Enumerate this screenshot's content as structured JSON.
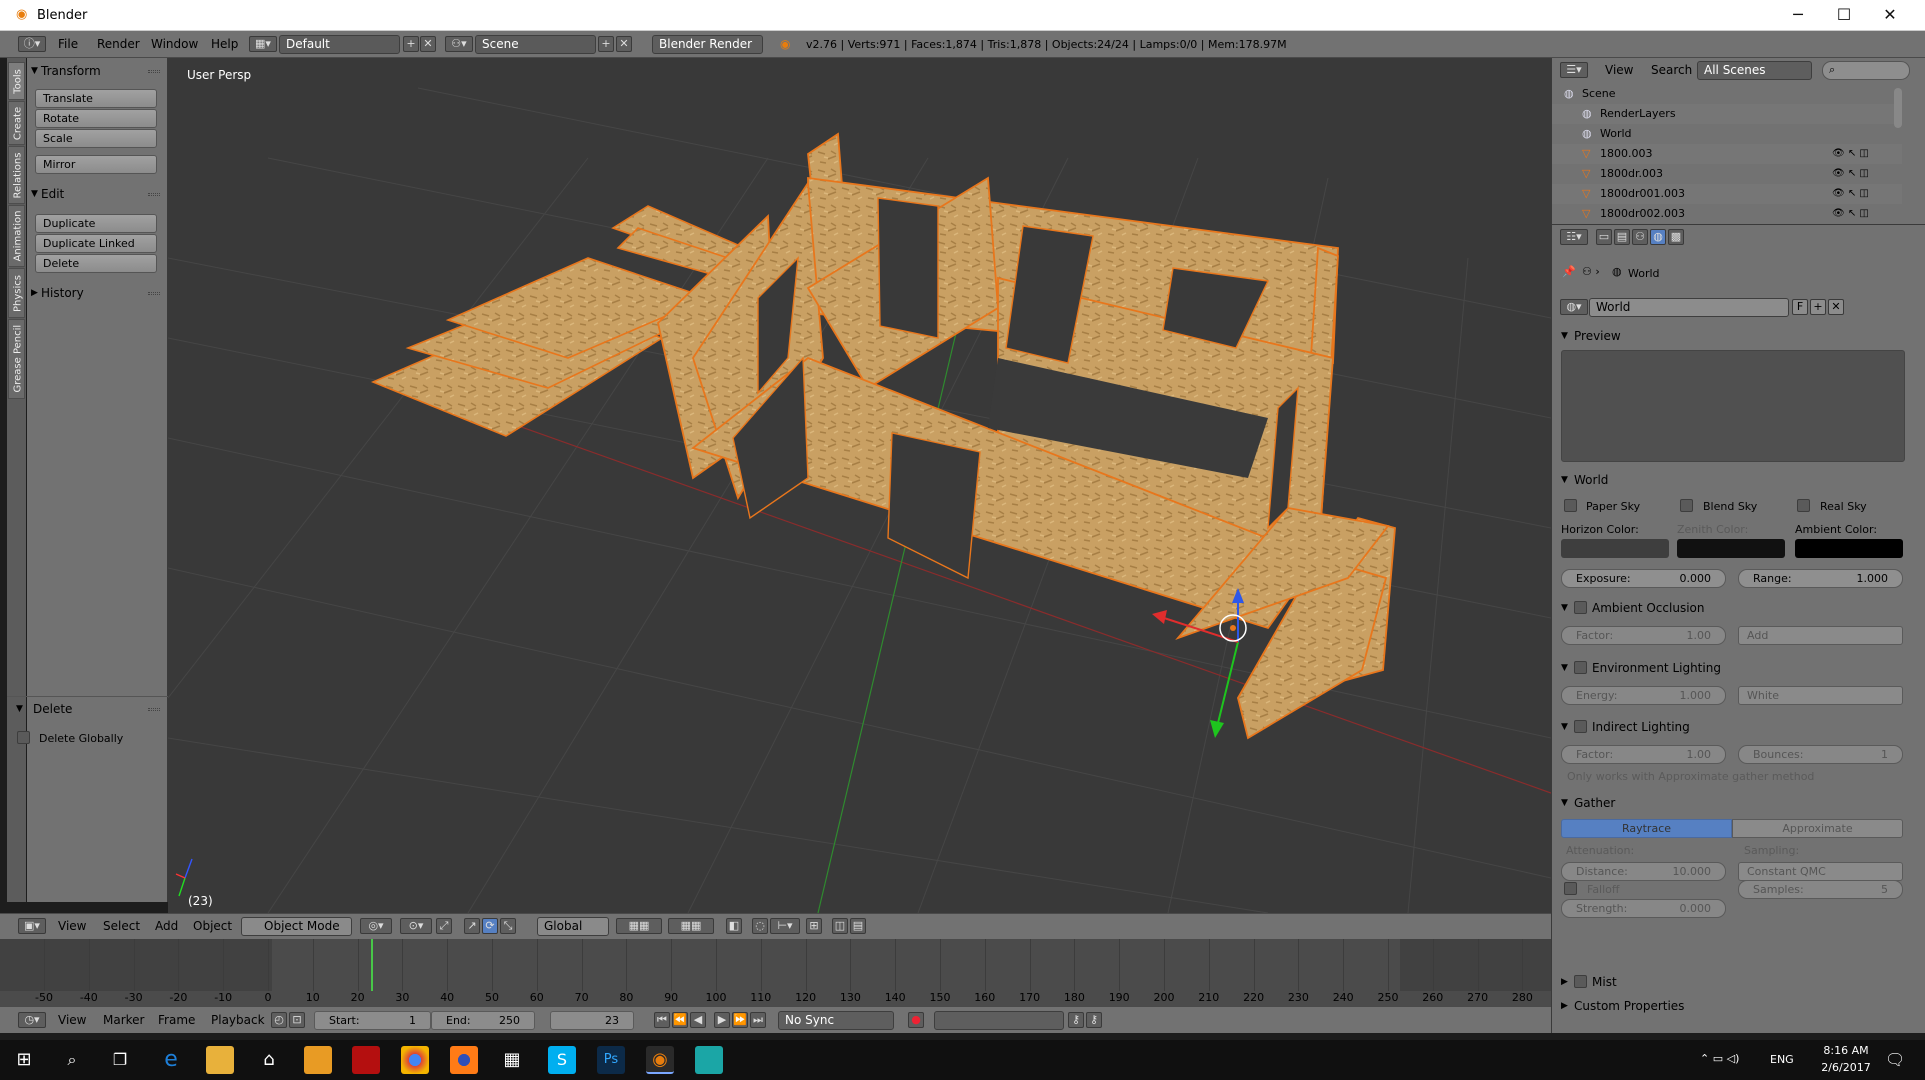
{
  "window": {
    "title": "Blender",
    "minimize": "─",
    "maximize": "☐",
    "close": "✕"
  },
  "info": {
    "menus": [
      "File",
      "Render",
      "Window",
      "Help"
    ],
    "screen": "Default",
    "scene": "Scene",
    "engine": "Blender Render",
    "stats": "v2.76 | Verts:971 | Faces:1,874 | Tris:1,878 | Objects:24/24 | Lamps:0/0 | Mem:178.97M"
  },
  "tool_tabs": [
    "Tools",
    "Create",
    "Relations",
    "Animation",
    "Physics",
    "Grease Pencil"
  ],
  "tool_shelf": {
    "transform_title": "Transform",
    "transform_buttons": [
      "Translate",
      "Rotate",
      "Scale"
    ],
    "mirror": "Mirror",
    "edit_title": "Edit",
    "edit_buttons": [
      "Duplicate",
      "Duplicate Linked",
      "Delete"
    ],
    "history_title": "History",
    "operator_title": "Delete",
    "operator_option": "Delete Globally"
  },
  "viewport": {
    "label": "User Persp",
    "frame_label": "(23)"
  },
  "view3d_header": {
    "menus": [
      "View",
      "Select",
      "Add",
      "Object"
    ],
    "mode": "Object Mode",
    "orientation": "Global"
  },
  "timeline": {
    "ticks": [
      "-50",
      "-40",
      "-30",
      "-20",
      "-10",
      "0",
      "10",
      "20",
      "30",
      "40",
      "50",
      "60",
      "70",
      "80",
      "90",
      "100",
      "110",
      "120",
      "130",
      "140",
      "150",
      "160",
      "170",
      "180",
      "190",
      "200",
      "210",
      "220",
      "230",
      "240",
      "250",
      "260",
      "270",
      "280"
    ],
    "current_frame": 23,
    "menus": [
      "View",
      "Marker",
      "Frame",
      "Playback"
    ],
    "start_label": "Start:",
    "start": "1",
    "end_label": "End:",
    "end": "250",
    "frame": "23",
    "sync": "No Sync"
  },
  "outliner": {
    "menus": [
      "View",
      "Search"
    ],
    "filter": "All Scenes",
    "rows": [
      {
        "name": "Scene",
        "indent": 0
      },
      {
        "name": "RenderLayers",
        "indent": 1
      },
      {
        "name": "World",
        "indent": 1
      },
      {
        "name": "1800.003",
        "indent": 1
      },
      {
        "name": "1800dr.003",
        "indent": 1
      },
      {
        "name": "1800dr001.003",
        "indent": 1
      },
      {
        "name": "1800dr002.003",
        "indent": 1
      }
    ]
  },
  "properties": {
    "breadcrumb": "World",
    "world_name": "World",
    "world_fake": "F",
    "preview_title": "Preview",
    "world_title": "World",
    "paper_sky": "Paper Sky",
    "blend_sky": "Blend Sky",
    "real_sky": "Real Sky",
    "horizon_color": "Horizon Color:",
    "zenith_color": "Zenith Color:",
    "ambient_color": "Ambient Color:",
    "exposure_label": "Exposure:",
    "exposure": "0.000",
    "range_label": "Range:",
    "range": "1.000",
    "ao_title": "Ambient Occlusion",
    "ao_factor_label": "Factor:",
    "ao_factor": "1.00",
    "ao_blend": "Add",
    "env_title": "Environment Lighting",
    "env_energy_label": "Energy:",
    "env_energy": "1.000",
    "env_color": "White",
    "indirect_title": "Indirect Lighting",
    "ind_factor_label": "Factor:",
    "ind_factor": "1.00",
    "ind_bounces_label": "Bounces:",
    "ind_bounces": "1",
    "ind_note": "Only works with Approximate gather method",
    "gather_title": "Gather",
    "gather_raytrace": "Raytrace",
    "gather_approx": "Approximate",
    "attenuation": "Attenuation:",
    "sampling": "Sampling:",
    "distance_label": "Distance:",
    "distance": "10.000",
    "sampling_method": "Constant QMC",
    "falloff": "Falloff",
    "samples_label": "Samples:",
    "samples": "5",
    "strength_label": "Strength:",
    "strength": "0.000",
    "mist_title": "Mist",
    "custom_title": "Custom Properties"
  },
  "taskbar": {
    "time": "8:16 AM",
    "date": "2/6/2017",
    "lang": "ENG"
  },
  "colors": {
    "accent": "#5680c2",
    "wood": "#c9a063",
    "select_orange": "#e8761c"
  }
}
